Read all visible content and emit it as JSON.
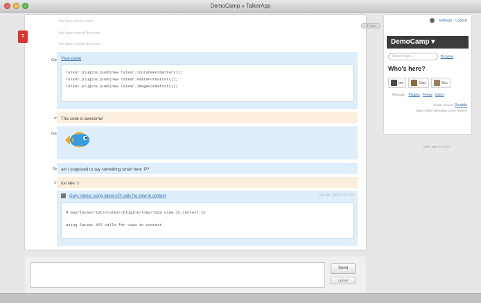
{
  "window": {
    "title": "DemoCamp » TalkerApp"
  },
  "system_messages": [
    "You have left the room",
    "You have entered the room",
    "You have entered the room"
  ],
  "messages": [
    {
      "user": "Gary",
      "link": "View paste",
      "code": [
        "Talker.plugins.push(new Talker.YoutubeFormatter());",
        "Talker.plugins.push(new Talker.PasteFormatter());",
        "Talker.plugins.push(new Talker.ImageFormatter());"
      ]
    },
    {
      "user": "me",
      "text": "This code is awesome!"
    },
    {
      "user": "Gary"
    },
    {
      "user": "Seu",
      "text": "am I supposed to say something smart here :P?"
    },
    {
      "user": "me",
      "text": "too late ☺"
    },
    {
      "link": "Gary Haran: using latest API calls for view in context",
      "time": "Dec 06, 2009 1:43 PM",
      "code": [
        "M app/javascripts/talker/plugins/logs/logs_view_in_context.js",
        "using latest API calls for view in context"
      ]
    }
  ],
  "pill_label": "0 Live",
  "sidebar": {
    "settings_label": "Settings",
    "logout_label": "Logout",
    "room_name": "DemoCamp ▾",
    "search_placeholder": "Search logs ...",
    "browse_label": "Browse",
    "whos_here_title": "Who's here?",
    "users": [
      "me",
      "Gary",
      "Seu"
    ],
    "manage_label": "Manage:",
    "manage_links": [
      "Plugins",
      "Feeds",
      "Users"
    ],
    "guest_access_label": "Guest Access:",
    "disable_label": "Disable",
    "guest_url": "https://talker.talkerapp.com/r/Yayfeelt"
  },
  "powered_by": "Talker ◀ Gray Time",
  "composer": {
    "send_label": "Send",
    "upload_label": "Upload"
  }
}
